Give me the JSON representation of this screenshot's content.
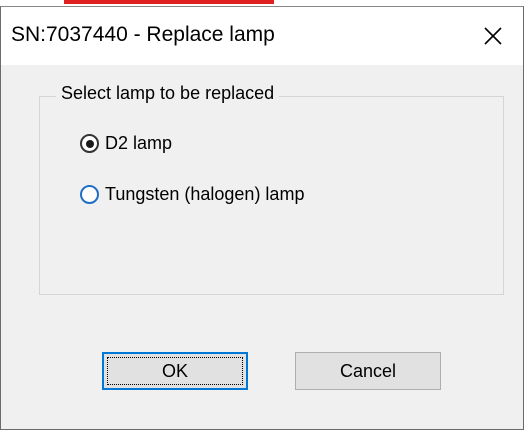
{
  "dialog": {
    "title": "SN:7037440 - Replace lamp",
    "close_icon": "close-icon"
  },
  "group": {
    "legend": "Select lamp to be replaced",
    "options": [
      {
        "label": "D2 lamp",
        "checked": true
      },
      {
        "label": "Tungsten (halogen) lamp",
        "checked": false
      }
    ]
  },
  "buttons": {
    "ok_label": "OK",
    "cancel_label": "Cancel"
  },
  "colors": {
    "accent": "#0078d7",
    "dialog_bg": "#f0f0f0"
  }
}
